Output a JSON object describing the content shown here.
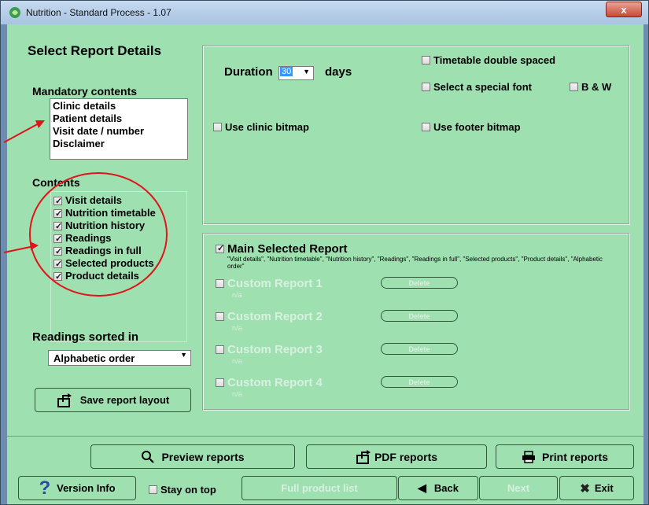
{
  "window": {
    "title": "Nutrition - Standard Process - 1.07",
    "close_label": "x"
  },
  "left": {
    "heading": "Select Report Details",
    "mandatory_heading": "Mandatory contents",
    "mandatory_items": [
      "Clinic details",
      "Patient details",
      "Visit date / number",
      "Disclaimer"
    ],
    "contents_heading": "Contents",
    "contents_items": [
      "Visit details",
      "Nutrition timetable",
      "Nutrition history",
      "Readings",
      "Readings in full",
      "Selected products",
      "Product details"
    ],
    "readings_heading": "Readings sorted in",
    "sort_value": "Alphabetic order",
    "save_button": "Save report layout"
  },
  "options": {
    "duration_label": "Duration",
    "duration_value": "30",
    "days_label": "days",
    "timetable_double_spaced": "Timetable double spaced",
    "select_special_font": "Select a special font",
    "bw_label": "B & W",
    "use_clinic_bitmap": "Use clinic bitmap",
    "use_footer_bitmap": "Use footer bitmap"
  },
  "reports": {
    "main_label": "Main Selected Report",
    "main_desc": "\"Visit details\", \"Nutrition timetable\", \"Nutrition history\", \"Readings\", \"Readings in full\", \"Selected products\", \"Product details\", \"Alphabetic order\"",
    "custom": [
      {
        "label": "Custom Report 1",
        "note": "n/a",
        "delete": "Delete"
      },
      {
        "label": "Custom Report 2",
        "note": "n/a",
        "delete": "Delete"
      },
      {
        "label": "Custom Report 3",
        "note": "n/a",
        "delete": "Delete"
      },
      {
        "label": "Custom Report 4",
        "note": "n/a",
        "delete": "Delete"
      }
    ]
  },
  "bottom": {
    "preview": "Preview reports",
    "pdf": "PDF reports",
    "print": "Print reports",
    "version": "Version Info",
    "stay_on_top": "Stay on top",
    "full_product_list": "Full product list",
    "back": "Back",
    "next": "Next",
    "exit": "Exit"
  },
  "colors": {
    "client_bg": "#9ee0b0",
    "annotation_red": "#e0141a"
  }
}
